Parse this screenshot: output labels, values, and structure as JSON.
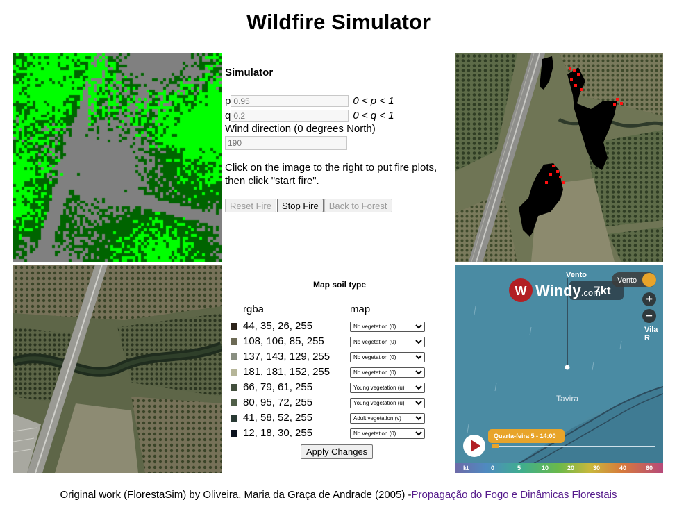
{
  "page": {
    "title": "Wildfire Simulator"
  },
  "simulator": {
    "heading": "Simulator",
    "p": {
      "label": "p",
      "value": "0.95",
      "condition": "0 < p < 1"
    },
    "q": {
      "label": "q",
      "value": "0.2",
      "condition": "0 < q < 1"
    },
    "wind": {
      "label": "Wind direction (0 degrees North)",
      "value": "190"
    },
    "note": "Click on the image to the right to put fire plots, then click \"start fire\".",
    "buttons": {
      "reset": "Reset Fire",
      "stop": "Stop Fire",
      "back": "Back to Forest"
    }
  },
  "soil": {
    "heading": "Map soil type",
    "col_rgba": "rgba",
    "col_map": "map",
    "rows": [
      {
        "rgba": "44, 35, 26, 255",
        "color": "#2c231a",
        "map": "No vegetation (0)"
      },
      {
        "rgba": "108, 106, 85, 255",
        "color": "#6c6a55",
        "map": "No vegetation (0)"
      },
      {
        "rgba": "137, 143, 129, 255",
        "color": "#898f81",
        "map": "No vegetation (0)"
      },
      {
        "rgba": "181, 181, 152, 255",
        "color": "#b5b598",
        "map": "No vegetation (0)"
      },
      {
        "rgba": "66, 79, 61, 255",
        "color": "#424f3d",
        "map": "Young vegetation (u)"
      },
      {
        "rgba": "80, 95, 72, 255",
        "color": "#505f48",
        "map": "Young vegetation (u)"
      },
      {
        "rgba": "41, 58, 52, 255",
        "color": "#293a34",
        "map": "Adult vegetation (v)"
      },
      {
        "rgba": "12, 18, 30, 255",
        "color": "#0c121e",
        "map": "No vegetation (0)"
      }
    ],
    "apply_label": "Apply Changes"
  },
  "windy": {
    "brand": "Windy",
    "brand_suffix": ".com",
    "speed": "7kt",
    "vento_top": "Vento",
    "vento_btn": "Vento",
    "place": "Tavira",
    "place2": "Vila R",
    "time": "Quarta-feira 5 - 14:00",
    "scale": [
      "kt",
      "0",
      "5",
      "10",
      "20",
      "30",
      "40",
      "60"
    ]
  },
  "footer": {
    "text": "Original work (FlorestaSim) by Oliveira, Maria da Graça de Andrade (2005) -",
    "link": "Propagação do Fogo e Dinâmicas Florestais"
  },
  "colors": {
    "veg_bright": "#00ff00",
    "veg_dark": "#006400",
    "veg_gray": "#808080",
    "fire_burnt": "#000000",
    "fire_active": "#ff0000"
  }
}
